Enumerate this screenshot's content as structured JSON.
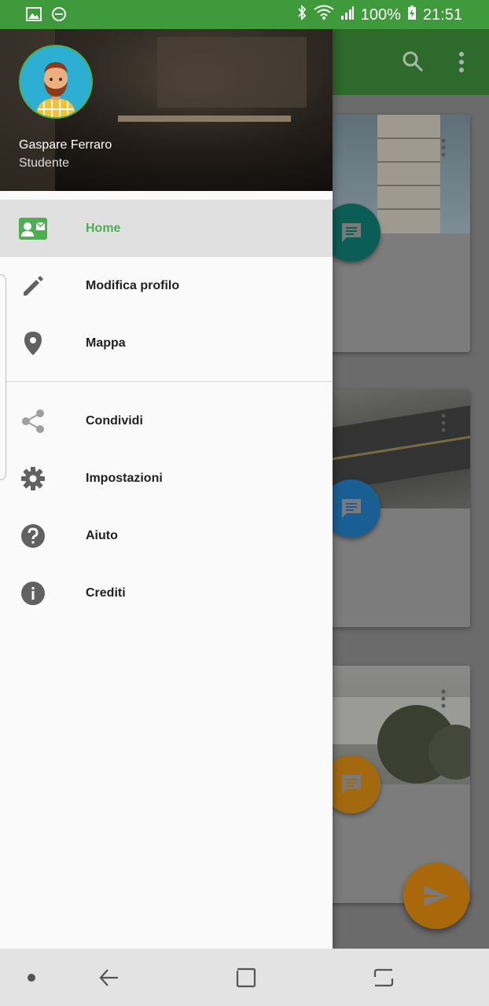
{
  "status_bar": {
    "battery": "100%",
    "time": "21:51",
    "left_icons": [
      "image-icon",
      "do-not-disturb-icon"
    ],
    "right_icons": [
      "bluetooth-icon",
      "wifi-icon",
      "signal-icon",
      "battery-charging-icon"
    ]
  },
  "toolbar": {
    "icons": [
      "search-icon",
      "more-vert-icon"
    ]
  },
  "drawer": {
    "user_name": "Gaspare Ferraro",
    "user_role": "Studente",
    "items": [
      {
        "label": "Home",
        "icon": "contact-card-icon",
        "active": true
      },
      {
        "label": "Modifica profilo",
        "icon": "pencil-icon"
      },
      {
        "label": "Mappa",
        "icon": "map-pin-icon"
      },
      {
        "label": "Condividi",
        "icon": "share-icon"
      },
      {
        "label": "Impostazioni",
        "icon": "gear-icon"
      },
      {
        "label": "Aiuto",
        "icon": "help-icon"
      },
      {
        "label": "Crediti",
        "icon": "info-icon"
      }
    ]
  },
  "colors": {
    "primary": "#4caf50",
    "status_bar": "#3f9a3b",
    "fab_teal": "#009688",
    "fab_blue": "#2196f3",
    "fab_orange": "#ff9800"
  },
  "nav_bar": {
    "icons": [
      "dot-icon",
      "back-icon",
      "home-square-icon",
      "recent-apps-icon"
    ]
  }
}
